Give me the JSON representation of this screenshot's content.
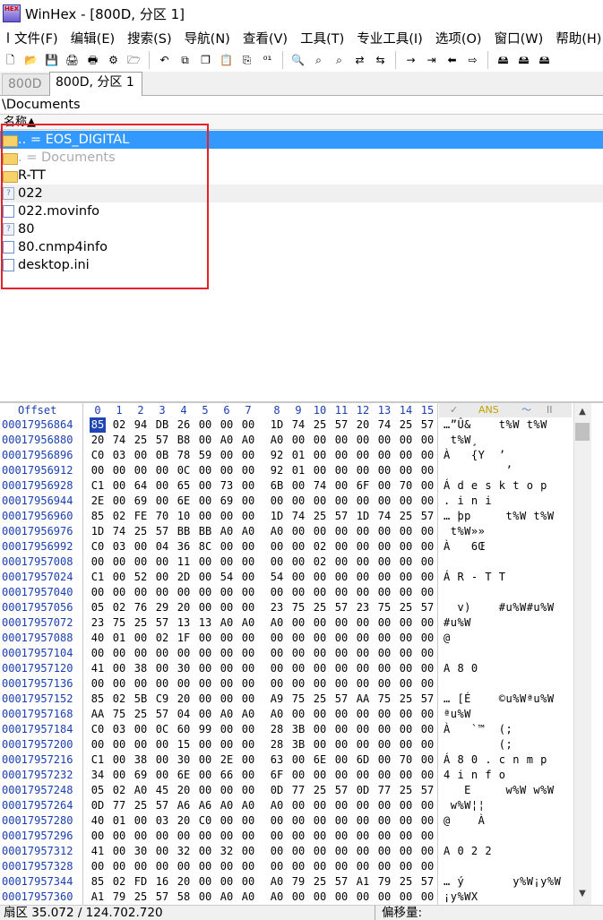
{
  "window": {
    "title": "WinHex - [800D, 分区 1]",
    "logo_text": "HEX"
  },
  "menu": [
    "文件(F)",
    "编辑(E)",
    "搜索(S)",
    "导航(N)",
    "查看(V)",
    "工具(T)",
    "专业工具(I)",
    "选项(O)",
    "窗口(W)",
    "帮助(H)"
  ],
  "toolbar": {
    "group1": [
      {
        "name": "new-icon",
        "glyph": "🗋"
      },
      {
        "name": "open-icon",
        "glyph": "📂"
      },
      {
        "name": "save-icon",
        "glyph": "💾"
      },
      {
        "name": "print-icon",
        "glyph": "🖨"
      },
      {
        "name": "properties-icon",
        "glyph": "🖶"
      },
      {
        "name": "settings-icon",
        "glyph": "⚙"
      },
      {
        "name": "disk-open-icon",
        "glyph": "🗁"
      }
    ],
    "group2": [
      {
        "name": "undo-icon",
        "glyph": "↶"
      },
      {
        "name": "copy-icon",
        "glyph": "⧉"
      },
      {
        "name": "copy-block-icon",
        "glyph": "❐"
      },
      {
        "name": "paste-icon",
        "glyph": "📋"
      },
      {
        "name": "paste-block-icon",
        "glyph": "⎘"
      },
      {
        "name": "binary-icon",
        "glyph": "⁰¹"
      }
    ],
    "group3": [
      {
        "name": "find-icon",
        "glyph": "🔍"
      },
      {
        "name": "find-text-icon",
        "glyph": "⌕"
      },
      {
        "name": "find-hex-icon",
        "glyph": "⌕"
      },
      {
        "name": "replace-text-icon",
        "glyph": "⇄"
      },
      {
        "name": "replace-hex-icon",
        "glyph": "⇆"
      }
    ],
    "group4": [
      {
        "name": "goto-offset-icon",
        "glyph": "→"
      },
      {
        "name": "goto-position-icon",
        "glyph": "⇥"
      },
      {
        "name": "back-icon",
        "glyph": "⬅"
      },
      {
        "name": "forward-icon",
        "glyph": "⇨"
      }
    ],
    "group5": [
      {
        "name": "disk-icon",
        "glyph": "🖴"
      },
      {
        "name": "disk-clone-icon",
        "glyph": "🖴"
      },
      {
        "name": "disk-tools-icon",
        "glyph": "🖴"
      }
    ]
  },
  "tabs": [
    {
      "label": "800D"
    },
    {
      "label": "800D, 分区 1"
    }
  ],
  "path": "\\Documents",
  "list_header": {
    "name_col": "名称▲"
  },
  "files": [
    {
      "name": "..  =  EOS_DIGITAL",
      "icon": "folder",
      "state": "selected"
    },
    {
      "name": ".   =  Documents",
      "icon": "folder",
      "state": "dim"
    },
    {
      "name": "R-TT",
      "icon": "folder",
      "state": "normal"
    },
    {
      "name": "022",
      "icon": "unknown",
      "state": "alt"
    },
    {
      "name": "022.movinfo",
      "icon": "doc",
      "state": "normal"
    },
    {
      "name": "80",
      "icon": "unknown",
      "state": "normal"
    },
    {
      "name": "80.cnmp4info",
      "icon": "doc",
      "state": "normal"
    },
    {
      "name": "desktop.ini",
      "icon": "doc",
      "state": "normal"
    }
  ],
  "hex_header": {
    "offset_label": "Offset",
    "columns": [
      "0",
      "1",
      "2",
      "3",
      "4",
      "5",
      "6",
      "7",
      "8",
      "9",
      "10",
      "11",
      "12",
      "13",
      "14",
      "15"
    ],
    "ansi_label": "ANS",
    "ascii_label": "II"
  },
  "hex_rows": [
    {
      "offset": "00017956864",
      "bytes": [
        "85",
        "02",
        "94",
        "DB",
        "26",
        "00",
        "00",
        "00",
        "1D",
        "74",
        "25",
        "57",
        "20",
        "74",
        "25",
        "57"
      ],
      "text": "…”Û&    t%W t%W"
    },
    {
      "offset": "00017956880",
      "bytes": [
        "20",
        "74",
        "25",
        "57",
        "B8",
        "00",
        "A0",
        "A0",
        "A0",
        "00",
        "00",
        "00",
        "00",
        "00",
        "00",
        "00"
      ],
      "text": " t%W¸"
    },
    {
      "offset": "00017956896",
      "bytes": [
        "C0",
        "03",
        "00",
        "0B",
        "78",
        "59",
        "00",
        "00",
        "92",
        "01",
        "00",
        "00",
        "00",
        "00",
        "00",
        "00"
      ],
      "text": "À   {Y  ’"
    },
    {
      "offset": "00017956912",
      "bytes": [
        "00",
        "00",
        "00",
        "00",
        "0C",
        "00",
        "00",
        "00",
        "92",
        "01",
        "00",
        "00",
        "00",
        "00",
        "00",
        "00"
      ],
      "text": "         ’"
    },
    {
      "offset": "00017956928",
      "bytes": [
        "C1",
        "00",
        "64",
        "00",
        "65",
        "00",
        "73",
        "00",
        "6B",
        "00",
        "74",
        "00",
        "6F",
        "00",
        "70",
        "00"
      ],
      "text": "Á d e s k t o p"
    },
    {
      "offset": "00017956944",
      "bytes": [
        "2E",
        "00",
        "69",
        "00",
        "6E",
        "00",
        "69",
        "00",
        "00",
        "00",
        "00",
        "00",
        "00",
        "00",
        "00",
        "00"
      ],
      "text": ". i n i"
    },
    {
      "offset": "00017956960",
      "bytes": [
        "85",
        "02",
        "FE",
        "70",
        "10",
        "00",
        "00",
        "00",
        "1D",
        "74",
        "25",
        "57",
        "1D",
        "74",
        "25",
        "57"
      ],
      "text": "… þp     t%W t%W"
    },
    {
      "offset": "00017956976",
      "bytes": [
        "1D",
        "74",
        "25",
        "57",
        "BB",
        "BB",
        "A0",
        "A0",
        "A0",
        "00",
        "00",
        "00",
        "00",
        "00",
        "00",
        "00"
      ],
      "text": " t%W»»"
    },
    {
      "offset": "00017956992",
      "bytes": [
        "C0",
        "03",
        "00",
        "04",
        "36",
        "8C",
        "00",
        "00",
        "00",
        "00",
        "02",
        "00",
        "00",
        "00",
        "00",
        "00"
      ],
      "text": "À   6Œ"
    },
    {
      "offset": "00017957008",
      "bytes": [
        "00",
        "00",
        "00",
        "00",
        "11",
        "00",
        "00",
        "00",
        "00",
        "00",
        "02",
        "00",
        "00",
        "00",
        "00",
        "00"
      ],
      "text": ""
    },
    {
      "offset": "00017957024",
      "bytes": [
        "C1",
        "00",
        "52",
        "00",
        "2D",
        "00",
        "54",
        "00",
        "54",
        "00",
        "00",
        "00",
        "00",
        "00",
        "00",
        "00"
      ],
      "text": "Á R - T T"
    },
    {
      "offset": "00017957040",
      "bytes": [
        "00",
        "00",
        "00",
        "00",
        "00",
        "00",
        "00",
        "00",
        "00",
        "00",
        "00",
        "00",
        "00",
        "00",
        "00",
        "00"
      ],
      "text": ""
    },
    {
      "offset": "00017957056",
      "bytes": [
        "05",
        "02",
        "76",
        "29",
        "20",
        "00",
        "00",
        "00",
        "23",
        "75",
        "25",
        "57",
        "23",
        "75",
        "25",
        "57"
      ],
      "text": "  v)    #u%W#u%W"
    },
    {
      "offset": "00017957072",
      "bytes": [
        "23",
        "75",
        "25",
        "57",
        "13",
        "13",
        "A0",
        "A0",
        "A0",
        "00",
        "00",
        "00",
        "00",
        "00",
        "00",
        "00"
      ],
      "text": "#u%W"
    },
    {
      "offset": "00017957088",
      "bytes": [
        "40",
        "01",
        "00",
        "02",
        "1F",
        "00",
        "00",
        "00",
        "00",
        "00",
        "00",
        "00",
        "00",
        "00",
        "00",
        "00"
      ],
      "text": "@"
    },
    {
      "offset": "00017957104",
      "bytes": [
        "00",
        "00",
        "00",
        "00",
        "00",
        "00",
        "00",
        "00",
        "00",
        "00",
        "00",
        "00",
        "00",
        "00",
        "00",
        "00"
      ],
      "text": ""
    },
    {
      "offset": "00017957120",
      "bytes": [
        "41",
        "00",
        "38",
        "00",
        "30",
        "00",
        "00",
        "00",
        "00",
        "00",
        "00",
        "00",
        "00",
        "00",
        "00",
        "00"
      ],
      "text": "A 8 0"
    },
    {
      "offset": "00017957136",
      "bytes": [
        "00",
        "00",
        "00",
        "00",
        "00",
        "00",
        "00",
        "00",
        "00",
        "00",
        "00",
        "00",
        "00",
        "00",
        "00",
        "00"
      ],
      "text": ""
    },
    {
      "offset": "00017957152",
      "bytes": [
        "85",
        "02",
        "5B",
        "C9",
        "20",
        "00",
        "00",
        "00",
        "A9",
        "75",
        "25",
        "57",
        "AA",
        "75",
        "25",
        "57"
      ],
      "text": "… [É    ©u%Wªu%W"
    },
    {
      "offset": "00017957168",
      "bytes": [
        "AA",
        "75",
        "25",
        "57",
        "04",
        "00",
        "A0",
        "A0",
        "A0",
        "00",
        "00",
        "00",
        "00",
        "00",
        "00",
        "00"
      ],
      "text": "ªu%W"
    },
    {
      "offset": "00017957184",
      "bytes": [
        "C0",
        "03",
        "00",
        "0C",
        "60",
        "99",
        "00",
        "00",
        "28",
        "3B",
        "00",
        "00",
        "00",
        "00",
        "00",
        "00"
      ],
      "text": "À   `™  (;"
    },
    {
      "offset": "00017957200",
      "bytes": [
        "00",
        "00",
        "00",
        "00",
        "15",
        "00",
        "00",
        "00",
        "28",
        "3B",
        "00",
        "00",
        "00",
        "00",
        "00",
        "00"
      ],
      "text": "        (;"
    },
    {
      "offset": "00017957216",
      "bytes": [
        "C1",
        "00",
        "38",
        "00",
        "30",
        "00",
        "2E",
        "00",
        "63",
        "00",
        "6E",
        "00",
        "6D",
        "00",
        "70",
        "00"
      ],
      "text": "Á 8 0 . c n m p"
    },
    {
      "offset": "00017957232",
      "bytes": [
        "34",
        "00",
        "69",
        "00",
        "6E",
        "00",
        "66",
        "00",
        "6F",
        "00",
        "00",
        "00",
        "00",
        "00",
        "00",
        "00"
      ],
      "text": "4 i n f o"
    },
    {
      "offset": "00017957248",
      "bytes": [
        "05",
        "02",
        "A0",
        "45",
        "20",
        "00",
        "00",
        "00",
        "0D",
        "77",
        "25",
        "57",
        "0D",
        "77",
        "25",
        "57"
      ],
      "text": "   E     w%W w%W"
    },
    {
      "offset": "00017957264",
      "bytes": [
        "0D",
        "77",
        "25",
        "57",
        "A6",
        "A6",
        "A0",
        "A0",
        "A0",
        "00",
        "00",
        "00",
        "00",
        "00",
        "00",
        "00"
      ],
      "text": " w%W¦¦"
    },
    {
      "offset": "00017957280",
      "bytes": [
        "40",
        "01",
        "00",
        "03",
        "20",
        "C0",
        "00",
        "00",
        "00",
        "00",
        "00",
        "00",
        "00",
        "00",
        "00",
        "00"
      ],
      "text": "@    À"
    },
    {
      "offset": "00017957296",
      "bytes": [
        "00",
        "00",
        "00",
        "00",
        "00",
        "00",
        "00",
        "00",
        "00",
        "00",
        "00",
        "00",
        "00",
        "00",
        "00",
        "00"
      ],
      "text": ""
    },
    {
      "offset": "00017957312",
      "bytes": [
        "41",
        "00",
        "30",
        "00",
        "32",
        "00",
        "32",
        "00",
        "00",
        "00",
        "00",
        "00",
        "00",
        "00",
        "00",
        "00"
      ],
      "text": "A 0 2 2"
    },
    {
      "offset": "00017957328",
      "bytes": [
        "00",
        "00",
        "00",
        "00",
        "00",
        "00",
        "00",
        "00",
        "00",
        "00",
        "00",
        "00",
        "00",
        "00",
        "00",
        "00"
      ],
      "text": ""
    },
    {
      "offset": "00017957344",
      "bytes": [
        "85",
        "02",
        "FD",
        "16",
        "20",
        "00",
        "00",
        "00",
        "A0",
        "79",
        "25",
        "57",
        "A1",
        "79",
        "25",
        "57"
      ],
      "text": "… ý       y%W¡y%W"
    },
    {
      "offset": "00017957360",
      "bytes": [
        "A1",
        "79",
        "25",
        "57",
        "58",
        "00",
        "A0",
        "A0",
        "A0",
        "00",
        "00",
        "00",
        "00",
        "00",
        "00",
        "00"
      ],
      "text": "¡y%WX"
    }
  ],
  "status": {
    "sector": "扇区 35.072 / 124.702.720",
    "offset_label": "偏移量:"
  }
}
